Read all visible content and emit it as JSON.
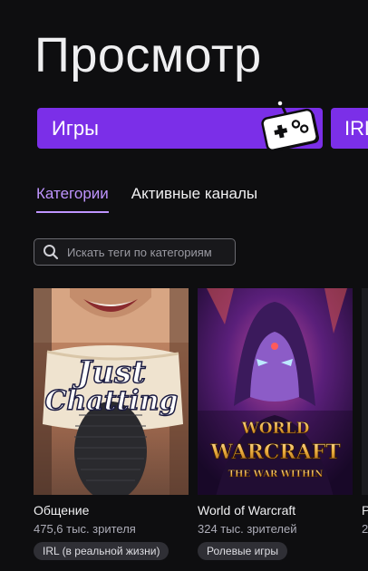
{
  "header": {
    "title": "Просмотр"
  },
  "category_buttons": [
    {
      "label": "Игры",
      "icon": "gamepad-icon"
    },
    {
      "label": "IRL"
    }
  ],
  "tabs": [
    {
      "label": "Категории",
      "active": true
    },
    {
      "label": "Активные каналы",
      "active": false
    }
  ],
  "search": {
    "placeholder": "Искать теги по категориям"
  },
  "cards": [
    {
      "name": "Общение",
      "viewers": "475,6 тыс. зрителя",
      "tag": "IRL (в реальной жизни)",
      "cover_text": [
        "Just",
        "Chatting"
      ]
    },
    {
      "name": "World of Warcraft",
      "viewers": "324 тыс. зрителей",
      "tag": "Ролевые игры",
      "cover_text": [
        "WORLD",
        "WARCRAFT",
        "THE WAR WITHIN"
      ]
    },
    {
      "name": "P",
      "viewers": "2",
      "tag": ""
    }
  ],
  "colors": {
    "background": "#0e0e10",
    "accent": "#7b2fe8",
    "tab_active": "#bf94ff",
    "tag_bg": "#2f2f35"
  }
}
